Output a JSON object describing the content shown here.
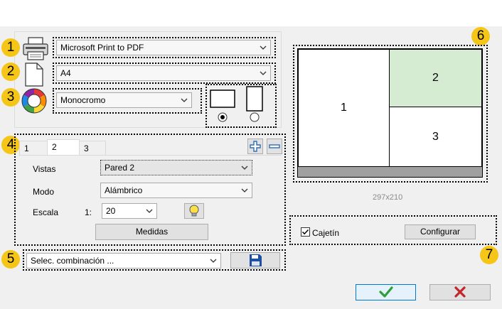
{
  "markers": [
    "1",
    "2",
    "3",
    "4",
    "5",
    "6",
    "7"
  ],
  "printer": {
    "selected": "Microsoft Print to PDF"
  },
  "paper": {
    "selected": "A4"
  },
  "color": {
    "selected": "Monocromo"
  },
  "tabs": [
    {
      "label": "1"
    },
    {
      "label": "2"
    },
    {
      "label": "3"
    }
  ],
  "view": {
    "vistas_label": "Vistas",
    "vistas_value": "Pared 2",
    "modo_label": "Modo",
    "modo_value": "Alámbrico",
    "escala_label": "Escala",
    "escala_prefix": "1:",
    "escala_value": "20",
    "medidas_label": "Medidas"
  },
  "combination": {
    "placeholder": "Selec. combinación ..."
  },
  "preview": {
    "cells": [
      "1",
      "2",
      "3"
    ],
    "size_label": "297x210",
    "highlight_color": "#d5ecd2"
  },
  "cajetin": {
    "checkbox_label": "Cajetín",
    "checked": true,
    "configure_label": "Configurar"
  },
  "colors": {
    "ok_green": "#2e9e3a",
    "cancel_red": "#c0262c",
    "save_blue": "#1e4fa3",
    "marker_yellow": "#f5c518"
  }
}
